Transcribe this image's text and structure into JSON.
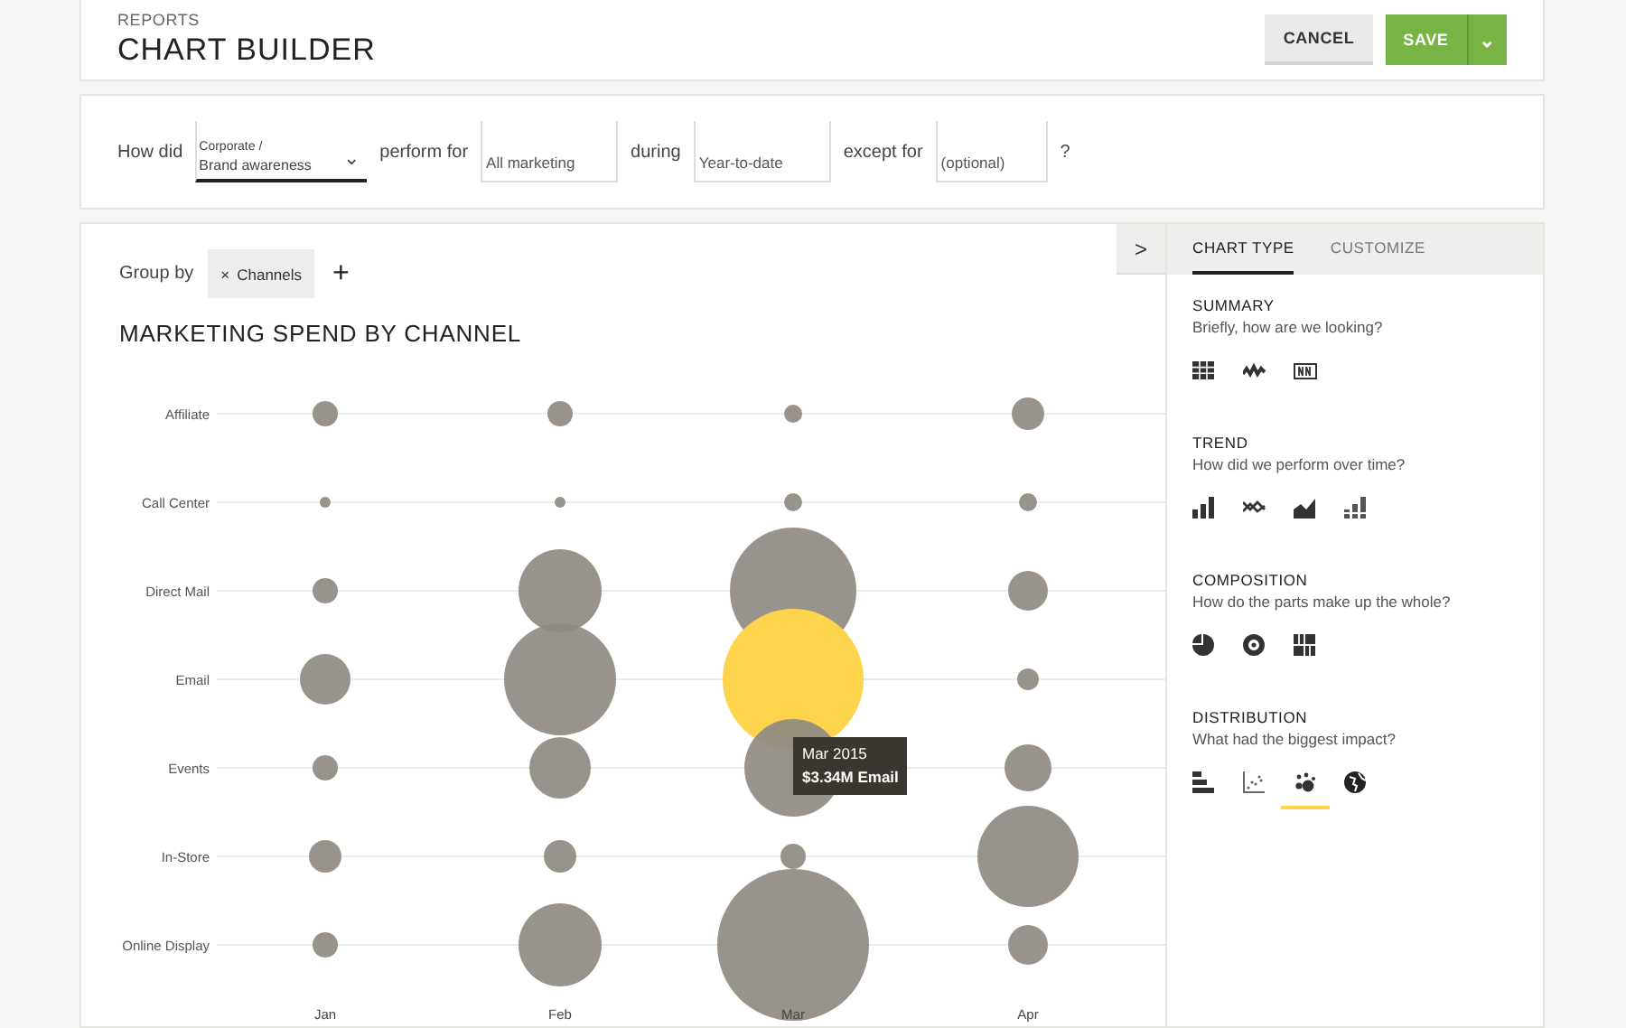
{
  "header": {
    "breadcrumb": "REPORTS",
    "title": "CHART BUILDER",
    "buttons": [
      {
        "kind": "secondary",
        "label": "CANCEL"
      },
      {
        "kind": "primary",
        "label": "SAVE",
        "caret": "⌄"
      }
    ]
  },
  "query": {
    "parts": [
      {
        "kind": "text",
        "text": "How did"
      },
      {
        "kind": "dropdown",
        "line1": "Corporate /",
        "line2": "Brand awareness",
        "caret": "⌄"
      },
      {
        "kind": "text",
        "text": "perform for"
      },
      {
        "kind": "field",
        "value": "All marketing"
      },
      {
        "kind": "text",
        "text": "during"
      },
      {
        "kind": "field",
        "value": "Year-to-date"
      },
      {
        "kind": "text",
        "text": "except for"
      },
      {
        "kind": "field",
        "placeholder": "(optional)"
      },
      {
        "kind": "text",
        "text": "?"
      }
    ]
  },
  "chart": {
    "group_by_label": "Group by",
    "chips": [
      {
        "remove": "×",
        "label": "Channels"
      }
    ],
    "add": "+",
    "collapse": ">",
    "title": "MARKETING SPEND BY CHANNEL",
    "rows": [
      {
        "label": "Affiliate",
        "selected": false
      },
      {
        "label": "Call Center",
        "selected": false
      },
      {
        "label": "Direct Mail",
        "selected": false
      },
      {
        "label": "Email",
        "selected": true
      },
      {
        "label": "Events",
        "selected": false
      },
      {
        "label": "In-Store",
        "selected": false
      },
      {
        "label": "Online Display",
        "selected": false
      }
    ],
    "columns": [
      "Jan",
      "Feb",
      "Mar",
      "Apr"
    ],
    "tooltip": {
      "title": "Mar 2015",
      "value": "$3.34M Email"
    }
  },
  "sidebar": {
    "tabs": [
      {
        "label": "CHART TYPE",
        "selected": true
      },
      {
        "label": "CUSTOMIZE",
        "selected": false
      }
    ],
    "sections": [
      {
        "title": "SUMMARY",
        "question": "Briefly, how are we looking?",
        "items": [
          {
            "kind": "table",
            "selected": false
          },
          {
            "kind": "sparkline",
            "selected": false
          },
          {
            "kind": "number",
            "selected": false
          }
        ]
      },
      {
        "title": "TREND",
        "question": "How did we perform over time?",
        "items": [
          {
            "kind": "bars",
            "selected": false
          },
          {
            "kind": "lines",
            "selected": false
          },
          {
            "kind": "area",
            "selected": false
          },
          {
            "kind": "stacked",
            "selected": false
          }
        ]
      },
      {
        "title": "COMPOSITION",
        "question": "How do the parts make up the whole?",
        "items": [
          {
            "kind": "pie",
            "selected": false
          },
          {
            "kind": "donut",
            "selected": false
          },
          {
            "kind": "treemap",
            "selected": false
          }
        ]
      },
      {
        "title": "DISTRIBUTION",
        "question": "What had the biggest impact?",
        "items": [
          {
            "kind": "hbars",
            "selected": false
          },
          {
            "kind": "scatter",
            "selected": false
          },
          {
            "kind": "bubble",
            "selected": true
          },
          {
            "kind": "map",
            "selected": false
          }
        ]
      }
    ]
  }
}
